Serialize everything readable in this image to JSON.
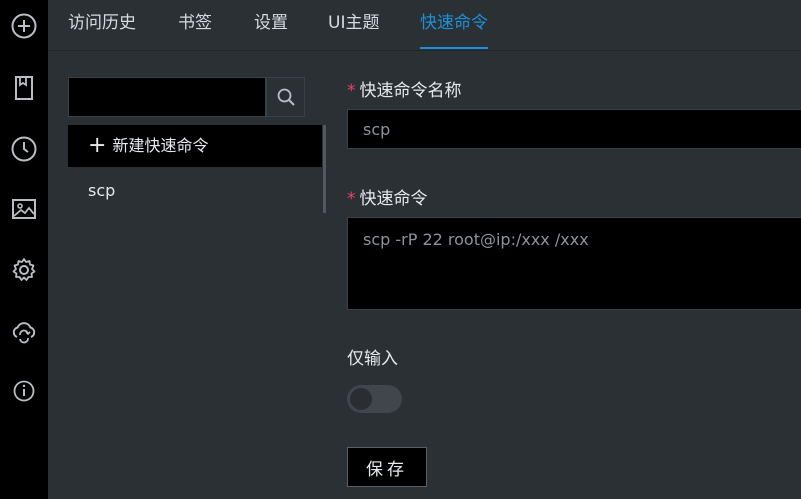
{
  "rail": {
    "icons": [
      "plus-circle-icon",
      "bookmark-icon",
      "clock-icon",
      "image-icon",
      "gear-icon",
      "cloud-sync-icon",
      "info-icon"
    ]
  },
  "tabs": [
    {
      "label": "访问历史"
    },
    {
      "label": "书签"
    },
    {
      "label": "设置"
    },
    {
      "label": "UI主题"
    },
    {
      "label": "快速命令",
      "active": true
    }
  ],
  "search": {
    "value": "",
    "placeholder": ""
  },
  "list": {
    "new_label": "新建快速命令",
    "items": [
      {
        "label": "scp"
      }
    ]
  },
  "form": {
    "name_label": "快速命令名称",
    "name_value": "scp",
    "command_label": "快速命令",
    "command_value": "scp -rP 22 root@ip:/xxx /xxx",
    "input_only_label": "仅输入",
    "input_only_enabled": false,
    "save_label": "保存"
  },
  "colors": {
    "accent": "#1e90d6",
    "required": "#e8436a",
    "background": "#2b3035",
    "rail": "#000000"
  }
}
